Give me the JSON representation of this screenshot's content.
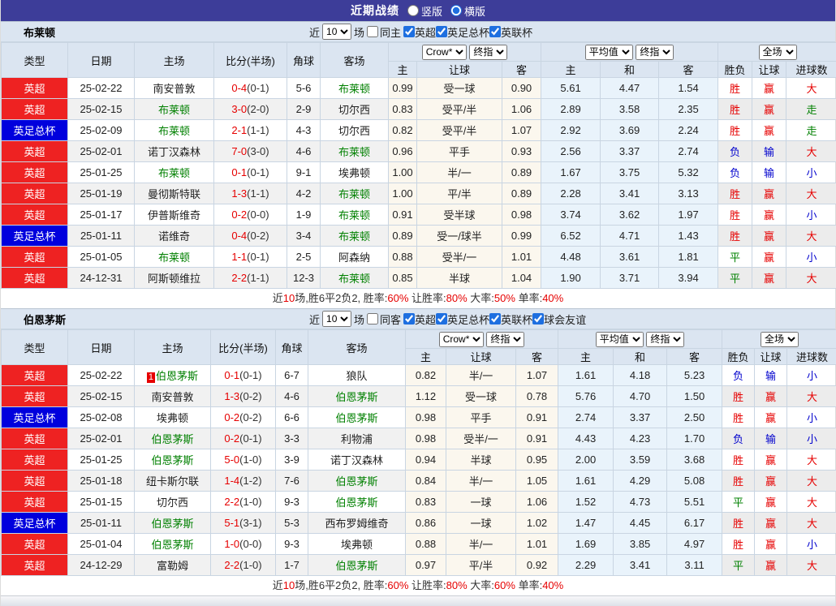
{
  "colors": {
    "purple": "#3d3d99",
    "league_red": "#ee2222",
    "league_blue": "#0000dd",
    "team_green": "#008000",
    "score_red": "#e60000",
    "win_red": "#e60000",
    "lose_blue": "#0000cd",
    "draw_green": "#008000",
    "header_bg": "#dbe5f1",
    "odds_bg": "#fbf7ee",
    "avg_bg": "#e9f3fb",
    "border": "#c9d5e2",
    "stripe": "#f1f1f1"
  },
  "title_bar": {
    "title": "近期战绩",
    "radio_vertical": "竖版",
    "radio_horizontal": "横版"
  },
  "labels": {
    "near": "近",
    "near_value": "10",
    "games": "场"
  },
  "header": {
    "cols": [
      "类型",
      "日期",
      "主场",
      "比分(半场)",
      "角球",
      "客场"
    ],
    "odds_source": "Crow*",
    "odds_time": "终指",
    "europe_type": "平均值",
    "europe_time": "终指",
    "period": "全场",
    "sub": [
      "主",
      "让球",
      "客",
      "主",
      "和",
      "客",
      "胜负",
      "让球",
      "进球数"
    ]
  },
  "sections": [
    {
      "team": "布莱顿",
      "filter": {
        "same_label": "同主",
        "leagues": [
          "英超",
          "英足总杯",
          "英联杯"
        ]
      },
      "rows": [
        {
          "league": "英超",
          "lc": "red",
          "date": "25-02-22",
          "home": "南安普敦",
          "hg": false,
          "hrc": "",
          "score": "0-4",
          "half": "(0-1)",
          "corner": "5-6",
          "away": "布莱顿",
          "ag": true,
          "o1": "0.99",
          "hd": "受一球",
          "o2": "0.90",
          "a1": "5.61",
          "a2": "4.47",
          "a3": "1.54",
          "r1": [
            "胜",
            "r"
          ],
          "r2": [
            "赢",
            "r"
          ],
          "r3": [
            "大",
            "r"
          ]
        },
        {
          "league": "英超",
          "lc": "red",
          "date": "25-02-15",
          "home": "布莱顿",
          "hg": true,
          "hrc": "",
          "score": "3-0",
          "half": "(2-0)",
          "corner": "2-9",
          "away": "切尔西",
          "ag": false,
          "o1": "0.83",
          "hd": "受平/半",
          "o2": "1.06",
          "a1": "2.89",
          "a2": "3.58",
          "a3": "2.35",
          "r1": [
            "胜",
            "r"
          ],
          "r2": [
            "赢",
            "r"
          ],
          "r3": [
            "走",
            "g"
          ]
        },
        {
          "league": "英足总杯",
          "lc": "blue",
          "date": "25-02-09",
          "home": "布莱顿",
          "hg": true,
          "hrc": "",
          "score": "2-1",
          "half": "(1-1)",
          "corner": "4-3",
          "away": "切尔西",
          "ag": false,
          "o1": "0.82",
          "hd": "受平/半",
          "o2": "1.07",
          "a1": "2.92",
          "a2": "3.69",
          "a3": "2.24",
          "r1": [
            "胜",
            "r"
          ],
          "r2": [
            "赢",
            "r"
          ],
          "r3": [
            "走",
            "g"
          ]
        },
        {
          "league": "英超",
          "lc": "red",
          "date": "25-02-01",
          "home": "诺丁汉森林",
          "hg": false,
          "hrc": "",
          "score": "7-0",
          "half": "(3-0)",
          "corner": "4-6",
          "away": "布莱顿",
          "ag": true,
          "o1": "0.96",
          "hd": "平手",
          "o2": "0.93",
          "a1": "2.56",
          "a2": "3.37",
          "a3": "2.74",
          "r1": [
            "负",
            "b"
          ],
          "r2": [
            "输",
            "b"
          ],
          "r3": [
            "大",
            "r"
          ]
        },
        {
          "league": "英超",
          "lc": "red",
          "date": "25-01-25",
          "home": "布莱顿",
          "hg": true,
          "hrc": "",
          "score": "0-1",
          "half": "(0-1)",
          "corner": "9-1",
          "away": "埃弗顿",
          "ag": false,
          "o1": "1.00",
          "hd": "半/一",
          "o2": "0.89",
          "a1": "1.67",
          "a2": "3.75",
          "a3": "5.32",
          "r1": [
            "负",
            "b"
          ],
          "r2": [
            "输",
            "b"
          ],
          "r3": [
            "小",
            "b"
          ]
        },
        {
          "league": "英超",
          "lc": "red",
          "date": "25-01-19",
          "home": "曼彻斯特联",
          "hg": false,
          "hrc": "",
          "score": "1-3",
          "half": "(1-1)",
          "corner": "4-2",
          "away": "布莱顿",
          "ag": true,
          "o1": "1.00",
          "hd": "平/半",
          "o2": "0.89",
          "a1": "2.28",
          "a2": "3.41",
          "a3": "3.13",
          "r1": [
            "胜",
            "r"
          ],
          "r2": [
            "赢",
            "r"
          ],
          "r3": [
            "大",
            "r"
          ]
        },
        {
          "league": "英超",
          "lc": "red",
          "date": "25-01-17",
          "home": "伊普斯维奇",
          "hg": false,
          "hrc": "",
          "score": "0-2",
          "half": "(0-0)",
          "corner": "1-9",
          "away": "布莱顿",
          "ag": true,
          "o1": "0.91",
          "hd": "受半球",
          "o2": "0.98",
          "a1": "3.74",
          "a2": "3.62",
          "a3": "1.97",
          "r1": [
            "胜",
            "r"
          ],
          "r2": [
            "赢",
            "r"
          ],
          "r3": [
            "小",
            "b"
          ]
        },
        {
          "league": "英足总杯",
          "lc": "blue",
          "date": "25-01-11",
          "home": "诺维奇",
          "hg": false,
          "hrc": "",
          "score": "0-4",
          "half": "(0-2)",
          "corner": "3-4",
          "away": "布莱顿",
          "ag": true,
          "o1": "0.89",
          "hd": "受一/球半",
          "o2": "0.99",
          "a1": "6.52",
          "a2": "4.71",
          "a3": "1.43",
          "r1": [
            "胜",
            "r"
          ],
          "r2": [
            "赢",
            "r"
          ],
          "r3": [
            "大",
            "r"
          ]
        },
        {
          "league": "英超",
          "lc": "red",
          "date": "25-01-05",
          "home": "布莱顿",
          "hg": true,
          "hrc": "",
          "score": "1-1",
          "half": "(0-1)",
          "corner": "2-5",
          "away": "阿森纳",
          "ag": false,
          "o1": "0.88",
          "hd": "受半/一",
          "o2": "1.01",
          "a1": "4.48",
          "a2": "3.61",
          "a3": "1.81",
          "r1": [
            "平",
            "g"
          ],
          "r2": [
            "赢",
            "r"
          ],
          "r3": [
            "小",
            "b"
          ]
        },
        {
          "league": "英超",
          "lc": "red",
          "date": "24-12-31",
          "home": "阿斯顿维拉",
          "hg": false,
          "hrc": "",
          "score": "2-2",
          "half": "(1-1)",
          "corner": "12-3",
          "away": "布莱顿",
          "ag": true,
          "o1": "0.85",
          "hd": "半球",
          "o2": "1.04",
          "a1": "1.90",
          "a2": "3.71",
          "a3": "3.94",
          "r1": [
            "平",
            "g"
          ],
          "r2": [
            "赢",
            "r"
          ],
          "r3": [
            "大",
            "r"
          ]
        }
      ],
      "summary": {
        "parts": [
          {
            "t": "近",
            "red": false
          },
          {
            "t": "10",
            "red": true
          },
          {
            "t": "场,胜6平2负2, 胜率:",
            "red": false
          },
          {
            "t": "60%",
            "red": true
          },
          {
            "t": " 让胜率:",
            "red": false
          },
          {
            "t": "80%",
            "red": true
          },
          {
            "t": " 大率:",
            "red": false
          },
          {
            "t": "50%",
            "red": true
          },
          {
            "t": " 单率:",
            "red": false
          },
          {
            "t": "40%",
            "red": true
          }
        ]
      }
    },
    {
      "team": "伯恩茅斯",
      "filter": {
        "same_label": "同客",
        "leagues": [
          "英超",
          "英足总杯",
          "英联杯",
          "球会友谊"
        ]
      },
      "rows": [
        {
          "league": "英超",
          "lc": "red",
          "date": "25-02-22",
          "home": "伯恩茅斯",
          "hg": true,
          "hrc": "1",
          "score": "0-1",
          "half": "(0-1)",
          "corner": "6-7",
          "away": "狼队",
          "ag": false,
          "o1": "0.82",
          "hd": "半/一",
          "o2": "1.07",
          "a1": "1.61",
          "a2": "4.18",
          "a3": "5.23",
          "r1": [
            "负",
            "b"
          ],
          "r2": [
            "输",
            "b"
          ],
          "r3": [
            "小",
            "b"
          ]
        },
        {
          "league": "英超",
          "lc": "red",
          "date": "25-02-15",
          "home": "南安普敦",
          "hg": false,
          "hrc": "",
          "score": "1-3",
          "half": "(0-2)",
          "corner": "4-6",
          "away": "伯恩茅斯",
          "ag": true,
          "o1": "1.12",
          "hd": "受一球",
          "o2": "0.78",
          "a1": "5.76",
          "a2": "4.70",
          "a3": "1.50",
          "r1": [
            "胜",
            "r"
          ],
          "r2": [
            "赢",
            "r"
          ],
          "r3": [
            "大",
            "r"
          ]
        },
        {
          "league": "英足总杯",
          "lc": "blue",
          "date": "25-02-08",
          "home": "埃弗顿",
          "hg": false,
          "hrc": "",
          "score": "0-2",
          "half": "(0-2)",
          "corner": "6-6",
          "away": "伯恩茅斯",
          "ag": true,
          "o1": "0.98",
          "hd": "平手",
          "o2": "0.91",
          "a1": "2.74",
          "a2": "3.37",
          "a3": "2.50",
          "r1": [
            "胜",
            "r"
          ],
          "r2": [
            "赢",
            "r"
          ],
          "r3": [
            "小",
            "b"
          ]
        },
        {
          "league": "英超",
          "lc": "red",
          "date": "25-02-01",
          "home": "伯恩茅斯",
          "hg": true,
          "hrc": "",
          "score": "0-2",
          "half": "(0-1)",
          "corner": "3-3",
          "away": "利物浦",
          "ag": false,
          "o1": "0.98",
          "hd": "受半/一",
          "o2": "0.91",
          "a1": "4.43",
          "a2": "4.23",
          "a3": "1.70",
          "r1": [
            "负",
            "b"
          ],
          "r2": [
            "输",
            "b"
          ],
          "r3": [
            "小",
            "b"
          ]
        },
        {
          "league": "英超",
          "lc": "red",
          "date": "25-01-25",
          "home": "伯恩茅斯",
          "hg": true,
          "hrc": "",
          "score": "5-0",
          "half": "(1-0)",
          "corner": "3-9",
          "away": "诺丁汉森林",
          "ag": false,
          "o1": "0.94",
          "hd": "半球",
          "o2": "0.95",
          "a1": "2.00",
          "a2": "3.59",
          "a3": "3.68",
          "r1": [
            "胜",
            "r"
          ],
          "r2": [
            "赢",
            "r"
          ],
          "r3": [
            "大",
            "r"
          ]
        },
        {
          "league": "英超",
          "lc": "red",
          "date": "25-01-18",
          "home": "纽卡斯尔联",
          "hg": false,
          "hrc": "",
          "score": "1-4",
          "half": "(1-2)",
          "corner": "7-6",
          "away": "伯恩茅斯",
          "ag": true,
          "o1": "0.84",
          "hd": "半/一",
          "o2": "1.05",
          "a1": "1.61",
          "a2": "4.29",
          "a3": "5.08",
          "r1": [
            "胜",
            "r"
          ],
          "r2": [
            "赢",
            "r"
          ],
          "r3": [
            "大",
            "r"
          ]
        },
        {
          "league": "英超",
          "lc": "red",
          "date": "25-01-15",
          "home": "切尔西",
          "hg": false,
          "hrc": "",
          "score": "2-2",
          "half": "(1-0)",
          "corner": "9-3",
          "away": "伯恩茅斯",
          "ag": true,
          "o1": "0.83",
          "hd": "一球",
          "o2": "1.06",
          "a1": "1.52",
          "a2": "4.73",
          "a3": "5.51",
          "r1": [
            "平",
            "g"
          ],
          "r2": [
            "赢",
            "r"
          ],
          "r3": [
            "大",
            "r"
          ]
        },
        {
          "league": "英足总杯",
          "lc": "blue",
          "date": "25-01-11",
          "home": "伯恩茅斯",
          "hg": true,
          "hrc": "",
          "score": "5-1",
          "half": "(3-1)",
          "corner": "5-3",
          "away": "西布罗姆维奇",
          "ag": false,
          "o1": "0.86",
          "hd": "一球",
          "o2": "1.02",
          "a1": "1.47",
          "a2": "4.45",
          "a3": "6.17",
          "r1": [
            "胜",
            "r"
          ],
          "r2": [
            "赢",
            "r"
          ],
          "r3": [
            "大",
            "r"
          ]
        },
        {
          "league": "英超",
          "lc": "red",
          "date": "25-01-04",
          "home": "伯恩茅斯",
          "hg": true,
          "hrc": "",
          "score": "1-0",
          "half": "(0-0)",
          "corner": "9-3",
          "away": "埃弗顿",
          "ag": false,
          "o1": "0.88",
          "hd": "半/一",
          "o2": "1.01",
          "a1": "1.69",
          "a2": "3.85",
          "a3": "4.97",
          "r1": [
            "胜",
            "r"
          ],
          "r2": [
            "赢",
            "r"
          ],
          "r3": [
            "小",
            "b"
          ]
        },
        {
          "league": "英超",
          "lc": "red",
          "date": "24-12-29",
          "home": "富勒姆",
          "hg": false,
          "hrc": "",
          "score": "2-2",
          "half": "(1-0)",
          "corner": "1-7",
          "away": "伯恩茅斯",
          "ag": true,
          "o1": "0.97",
          "hd": "平/半",
          "o2": "0.92",
          "a1": "2.29",
          "a2": "3.41",
          "a3": "3.11",
          "r1": [
            "平",
            "g"
          ],
          "r2": [
            "赢",
            "r"
          ],
          "r3": [
            "大",
            "r"
          ]
        }
      ],
      "summary": {
        "parts": [
          {
            "t": "近",
            "red": false
          },
          {
            "t": "10",
            "red": true
          },
          {
            "t": "场,胜6平2负2, 胜率:",
            "red": false
          },
          {
            "t": "60%",
            "red": true
          },
          {
            "t": " 让胜率:",
            "red": false
          },
          {
            "t": "80%",
            "red": true
          },
          {
            "t": " 大率:",
            "red": false
          },
          {
            "t": "60%",
            "red": true
          },
          {
            "t": " 单率:",
            "red": false
          },
          {
            "t": "40%",
            "red": true
          }
        ]
      }
    }
  ]
}
